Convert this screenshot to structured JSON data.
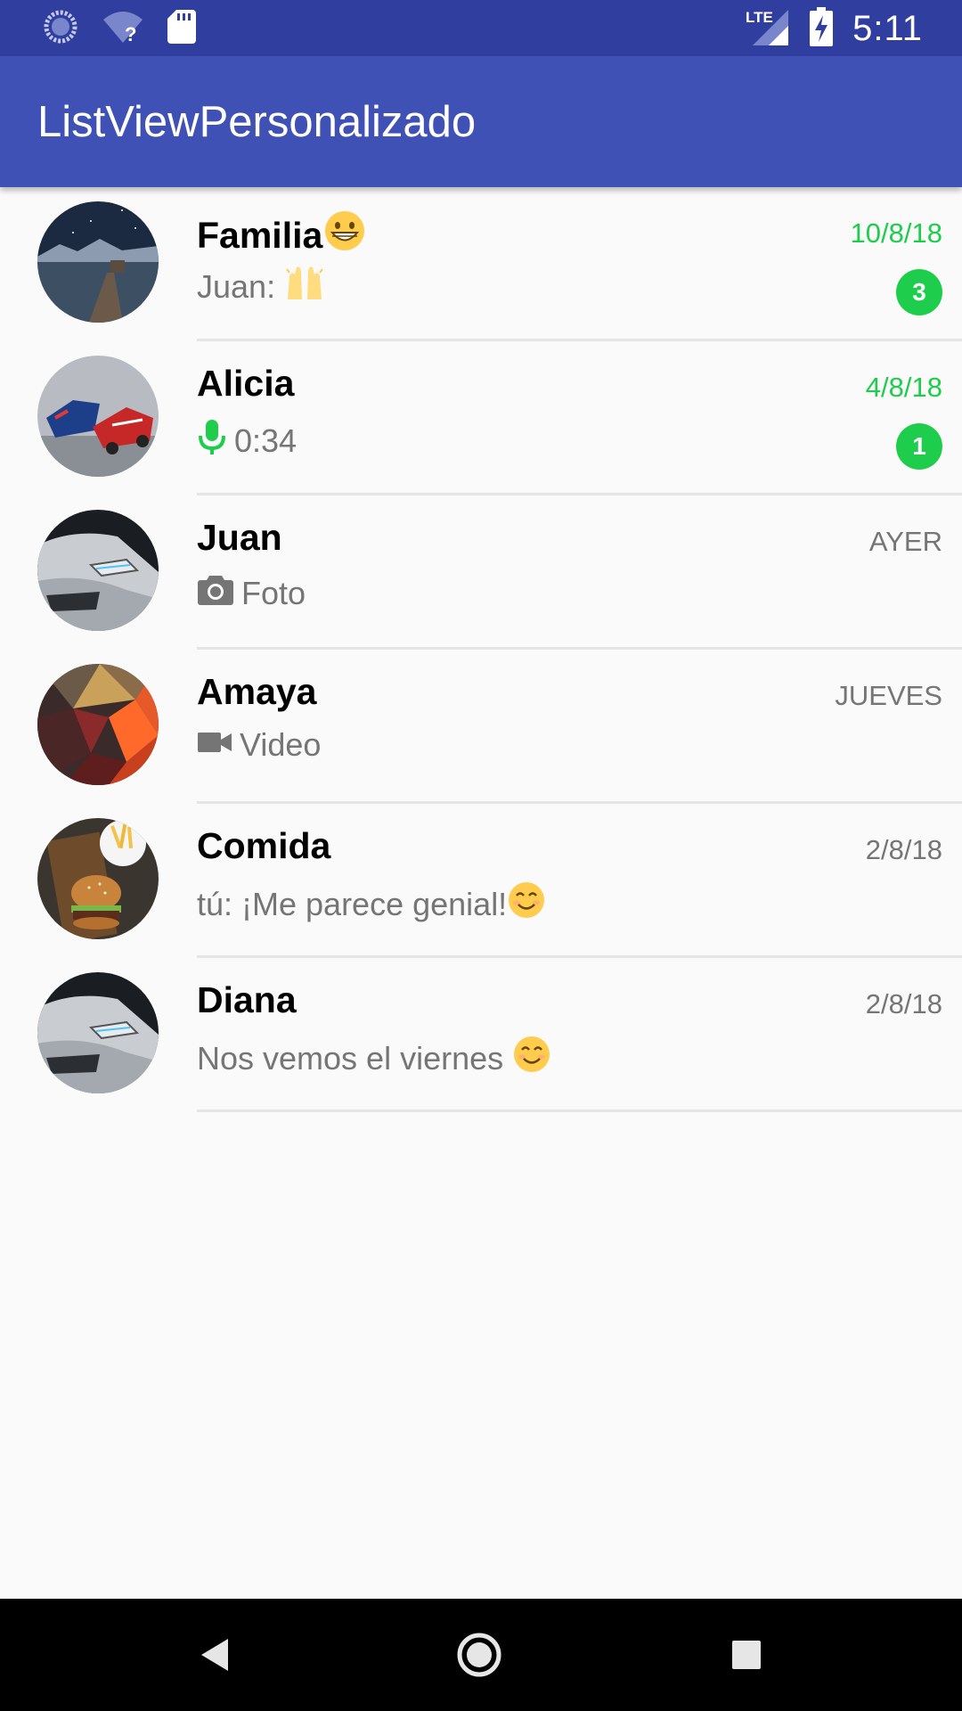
{
  "status_bar": {
    "time": "5:11",
    "network": "LTE",
    "icons": [
      "sync-icon",
      "wifi-question-icon",
      "sd-card-icon",
      "lte-signal-icon",
      "battery-charging-icon"
    ]
  },
  "app_bar": {
    "title": "ListViewPersonalizado",
    "color": "#3f51b5",
    "status_color": "#303f9f"
  },
  "accent_color": "#1ecd4b",
  "chats": [
    {
      "name": "Familia",
      "name_emoji": "grinning-face-icon",
      "time": "10/8/18",
      "unread": true,
      "badge": "3",
      "preview": "Juan: ",
      "preview_emoji": "raising-hands-icon",
      "avatar": "lake-pier-avatar"
    },
    {
      "name": "Alicia",
      "time": "4/8/18",
      "unread": true,
      "badge": "1",
      "preview": "0:34",
      "preview_icon": "microphone-icon",
      "avatar": "race-cars-avatar"
    },
    {
      "name": "Juan",
      "time": "AYER",
      "unread": false,
      "preview": "Foto",
      "preview_icon": "camera-icon",
      "avatar": "white-car-avatar"
    },
    {
      "name": "Amaya",
      "time": "JUEVES",
      "unread": false,
      "preview": "Video",
      "preview_icon": "videocam-icon",
      "avatar": "low-poly-avatar"
    },
    {
      "name": "Comida",
      "time": "2/8/18",
      "unread": false,
      "preview": "tú: ¡Me parece genial!",
      "preview_emoji": "smiling-face-icon",
      "avatar": "burger-fries-avatar"
    },
    {
      "name": "Diana",
      "time": "2/8/18",
      "unread": false,
      "preview": "Nos vemos el viernes ",
      "preview_emoji": "smiling-face-icon",
      "avatar": "white-car-avatar"
    }
  ],
  "nav_bar": {
    "buttons": [
      "back-icon",
      "home-icon",
      "recents-icon"
    ]
  }
}
